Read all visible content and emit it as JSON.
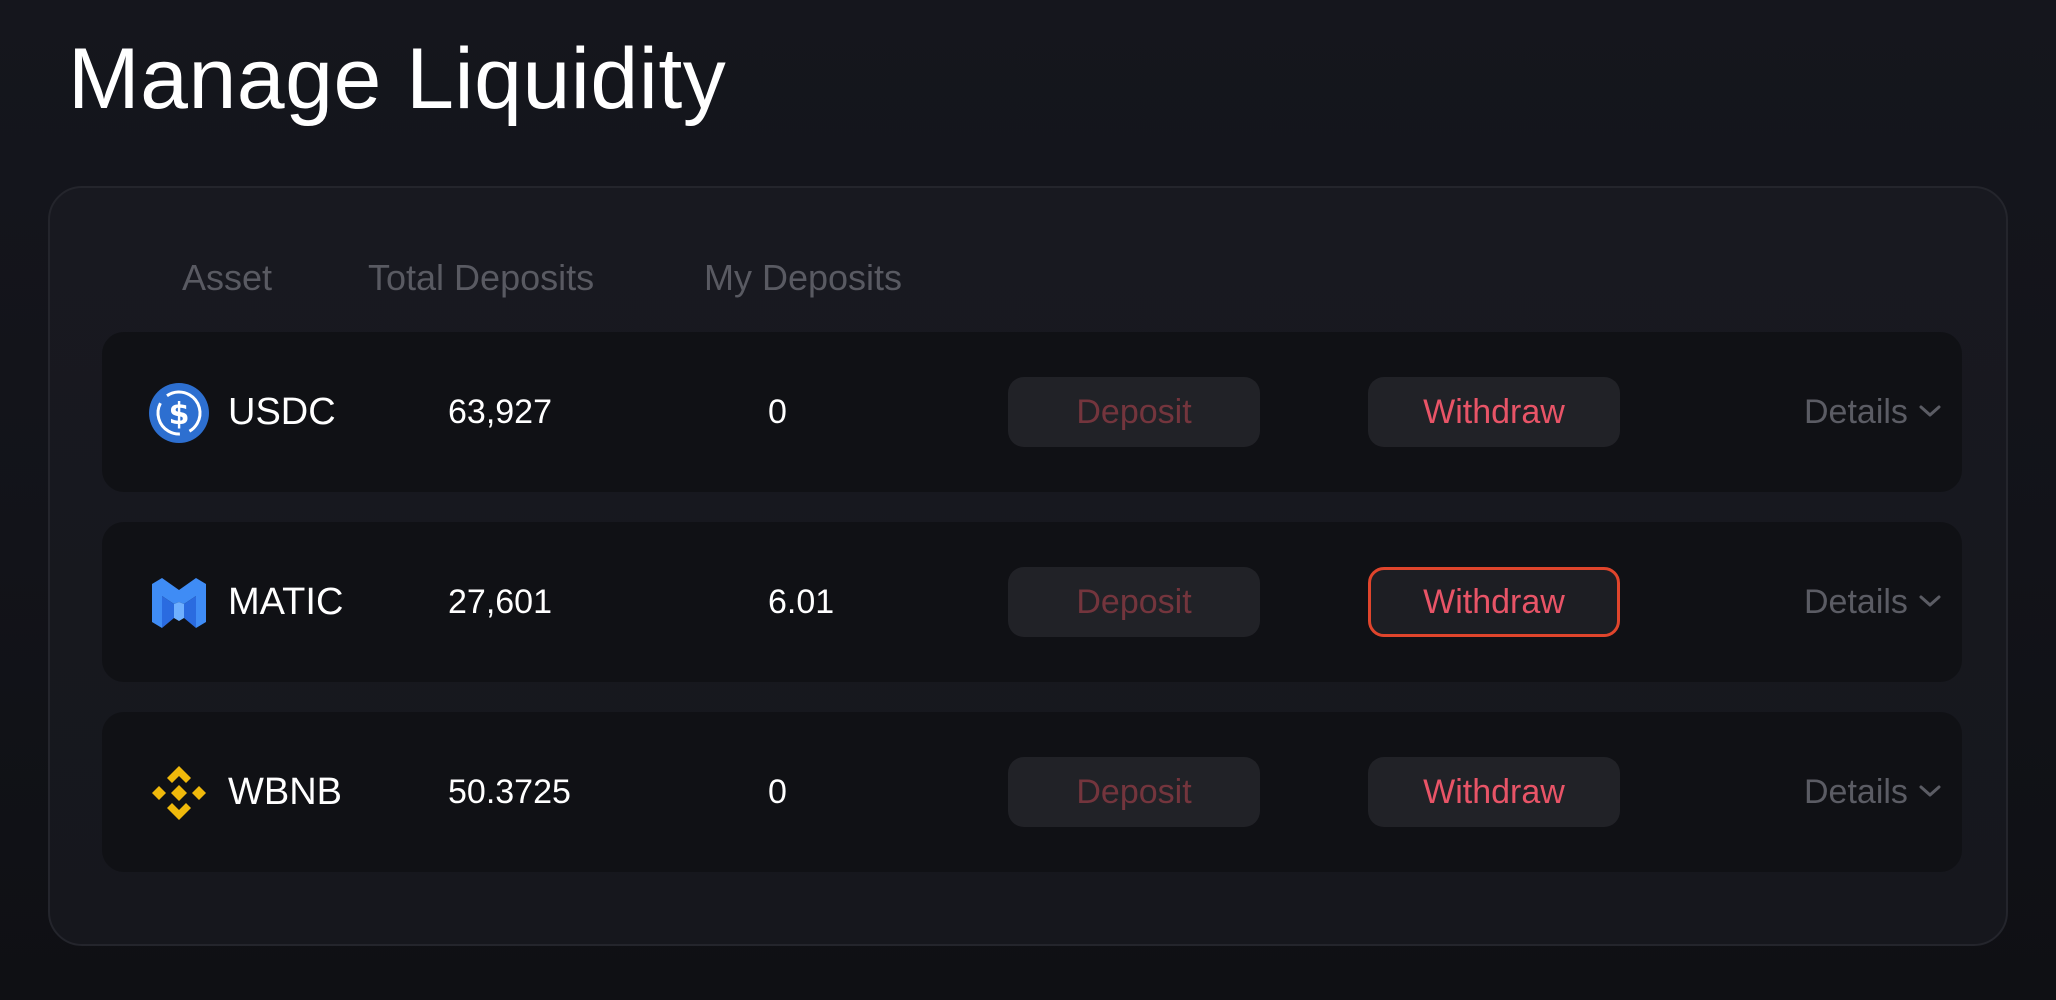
{
  "page": {
    "title": "Manage Liquidity"
  },
  "table": {
    "columns": {
      "asset": "Asset",
      "total_deposits": "Total Deposits",
      "my_deposits": "My Deposits"
    },
    "rows": [
      {
        "symbol": "USDC",
        "icon": "usdc-icon",
        "total_deposits": "63,927",
        "my_deposits": "0",
        "deposit_label": "Deposit",
        "withdraw_label": "Withdraw",
        "details_label": "Details"
      },
      {
        "symbol": "MATIC",
        "icon": "matic-icon",
        "total_deposits": "27,601",
        "my_deposits": "6.01",
        "deposit_label": "Deposit",
        "withdraw_label": "Withdraw",
        "details_label": "Details",
        "withdraw_focused": true
      },
      {
        "symbol": "WBNB",
        "icon": "wbnb-icon",
        "total_deposits": "50.3725",
        "my_deposits": "0",
        "deposit_label": "Deposit",
        "withdraw_label": "Withdraw",
        "details_label": "Details"
      }
    ]
  },
  "colors": {
    "accent_red": "#e85467",
    "focus_ring": "#e0452c",
    "usdc_blue": "#2775ca",
    "matic_blue": "#3f8cf5",
    "bnb_gold": "#f0b90b"
  }
}
